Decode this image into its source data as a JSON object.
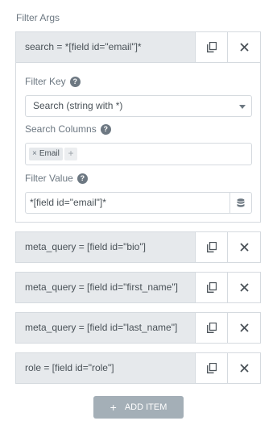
{
  "section": {
    "title": "Filter Args"
  },
  "expanded_item": {
    "title": "search = *[field id=\"email\"]*",
    "filter_key": {
      "label": "Filter Key",
      "value": "Search (string with *)"
    },
    "search_columns": {
      "label": "Search Columns",
      "tags": [
        "Email"
      ]
    },
    "filter_value": {
      "label": "Filter Value",
      "value": "*[field id=\"email\"]*"
    }
  },
  "items": [
    {
      "title": "meta_query = [field id=\"bio\"]"
    },
    {
      "title": "meta_query = [field id=\"first_name\"]"
    },
    {
      "title": "meta_query = [field id=\"last_name\"]"
    },
    {
      "title": "role = [field id=\"role\"]"
    }
  ],
  "add_button": {
    "label": "ADD ITEM"
  },
  "icons": {
    "help": "?",
    "tag_remove": "×",
    "tag_add": "+",
    "add": "+"
  }
}
